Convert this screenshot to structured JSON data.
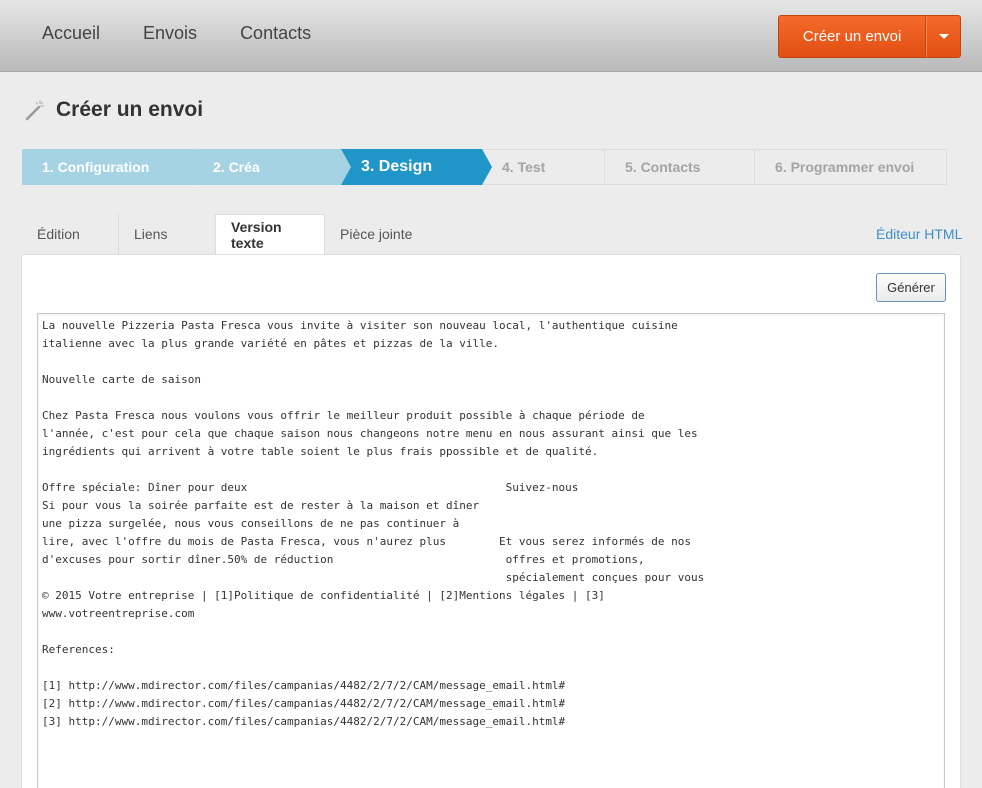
{
  "topnav": {
    "items": [
      "Accueil",
      "Envois",
      "Contacts"
    ],
    "create_button": "Créer un envoi"
  },
  "page": {
    "title": "Créer un envoi"
  },
  "steps": [
    {
      "label": "1. Configuration",
      "state": "done"
    },
    {
      "label": "2. Créa",
      "state": "done"
    },
    {
      "label": "3. Design",
      "state": "active"
    },
    {
      "label": "4. Test",
      "state": "todo"
    },
    {
      "label": "5. Contacts",
      "state": "todo"
    },
    {
      "label": "6. Programmer envoi",
      "state": "todo"
    }
  ],
  "tabs": [
    {
      "label": "Édition"
    },
    {
      "label": "Liens"
    },
    {
      "label": "Version texte",
      "active": true
    },
    {
      "label": "Pièce jointe"
    }
  ],
  "html_editor_link": "Éditeur HTML",
  "generate_button": "Générer",
  "text_version": "La nouvelle Pizzeria Pasta Fresca vous invite à visiter son nouveau local, l'authentique cuisine\nitalienne avec la plus grande variété en pâtes et pizzas de la ville.\n\nNouvelle carte de saison\n\nChez Pasta Fresca nous voulons vous offrir le meilleur produit possible à chaque période de\nl'année, c'est pour cela que chaque saison nous changeons notre menu en nous assurant ainsi que les\ningrédients qui arrivent à votre table soient le plus frais ppossible et de qualité.\n\nOffre spéciale: Dîner pour deux                                       Suivez-nous\nSi pour vous la soirée parfaite est de rester à la maison et dîner\nune pizza surgelée, nous vous conseillons de ne pas continuer à\nlire, avec l'offre du mois de Pasta Fresca, vous n'aurez plus        Et vous serez informés de nos\nd'excuses pour sortir dîner.50% de réduction                          offres et promotions,\n                                                                      spécialement conçues pour vous\n© 2015 Votre entreprise | [1]Politique de confidentialité | [2]Mentions légales | [3]\nwww.votreentreprise.com\n\nReferences:\n\n[1] http://www.mdirector.com/files/campanias/4482/2/7/2/CAM/message_email.html#\n[2] http://www.mdirector.com/files/campanias/4482/2/7/2/CAM/message_email.html#\n[3] http://www.mdirector.com/files/campanias/4482/2/7/2/CAM/message_email.html#",
  "colors": {
    "accent_orange": "#e24f12",
    "step_active": "#1f95c8",
    "step_done": "#a6d3e3",
    "link": "#3e8ecb"
  }
}
